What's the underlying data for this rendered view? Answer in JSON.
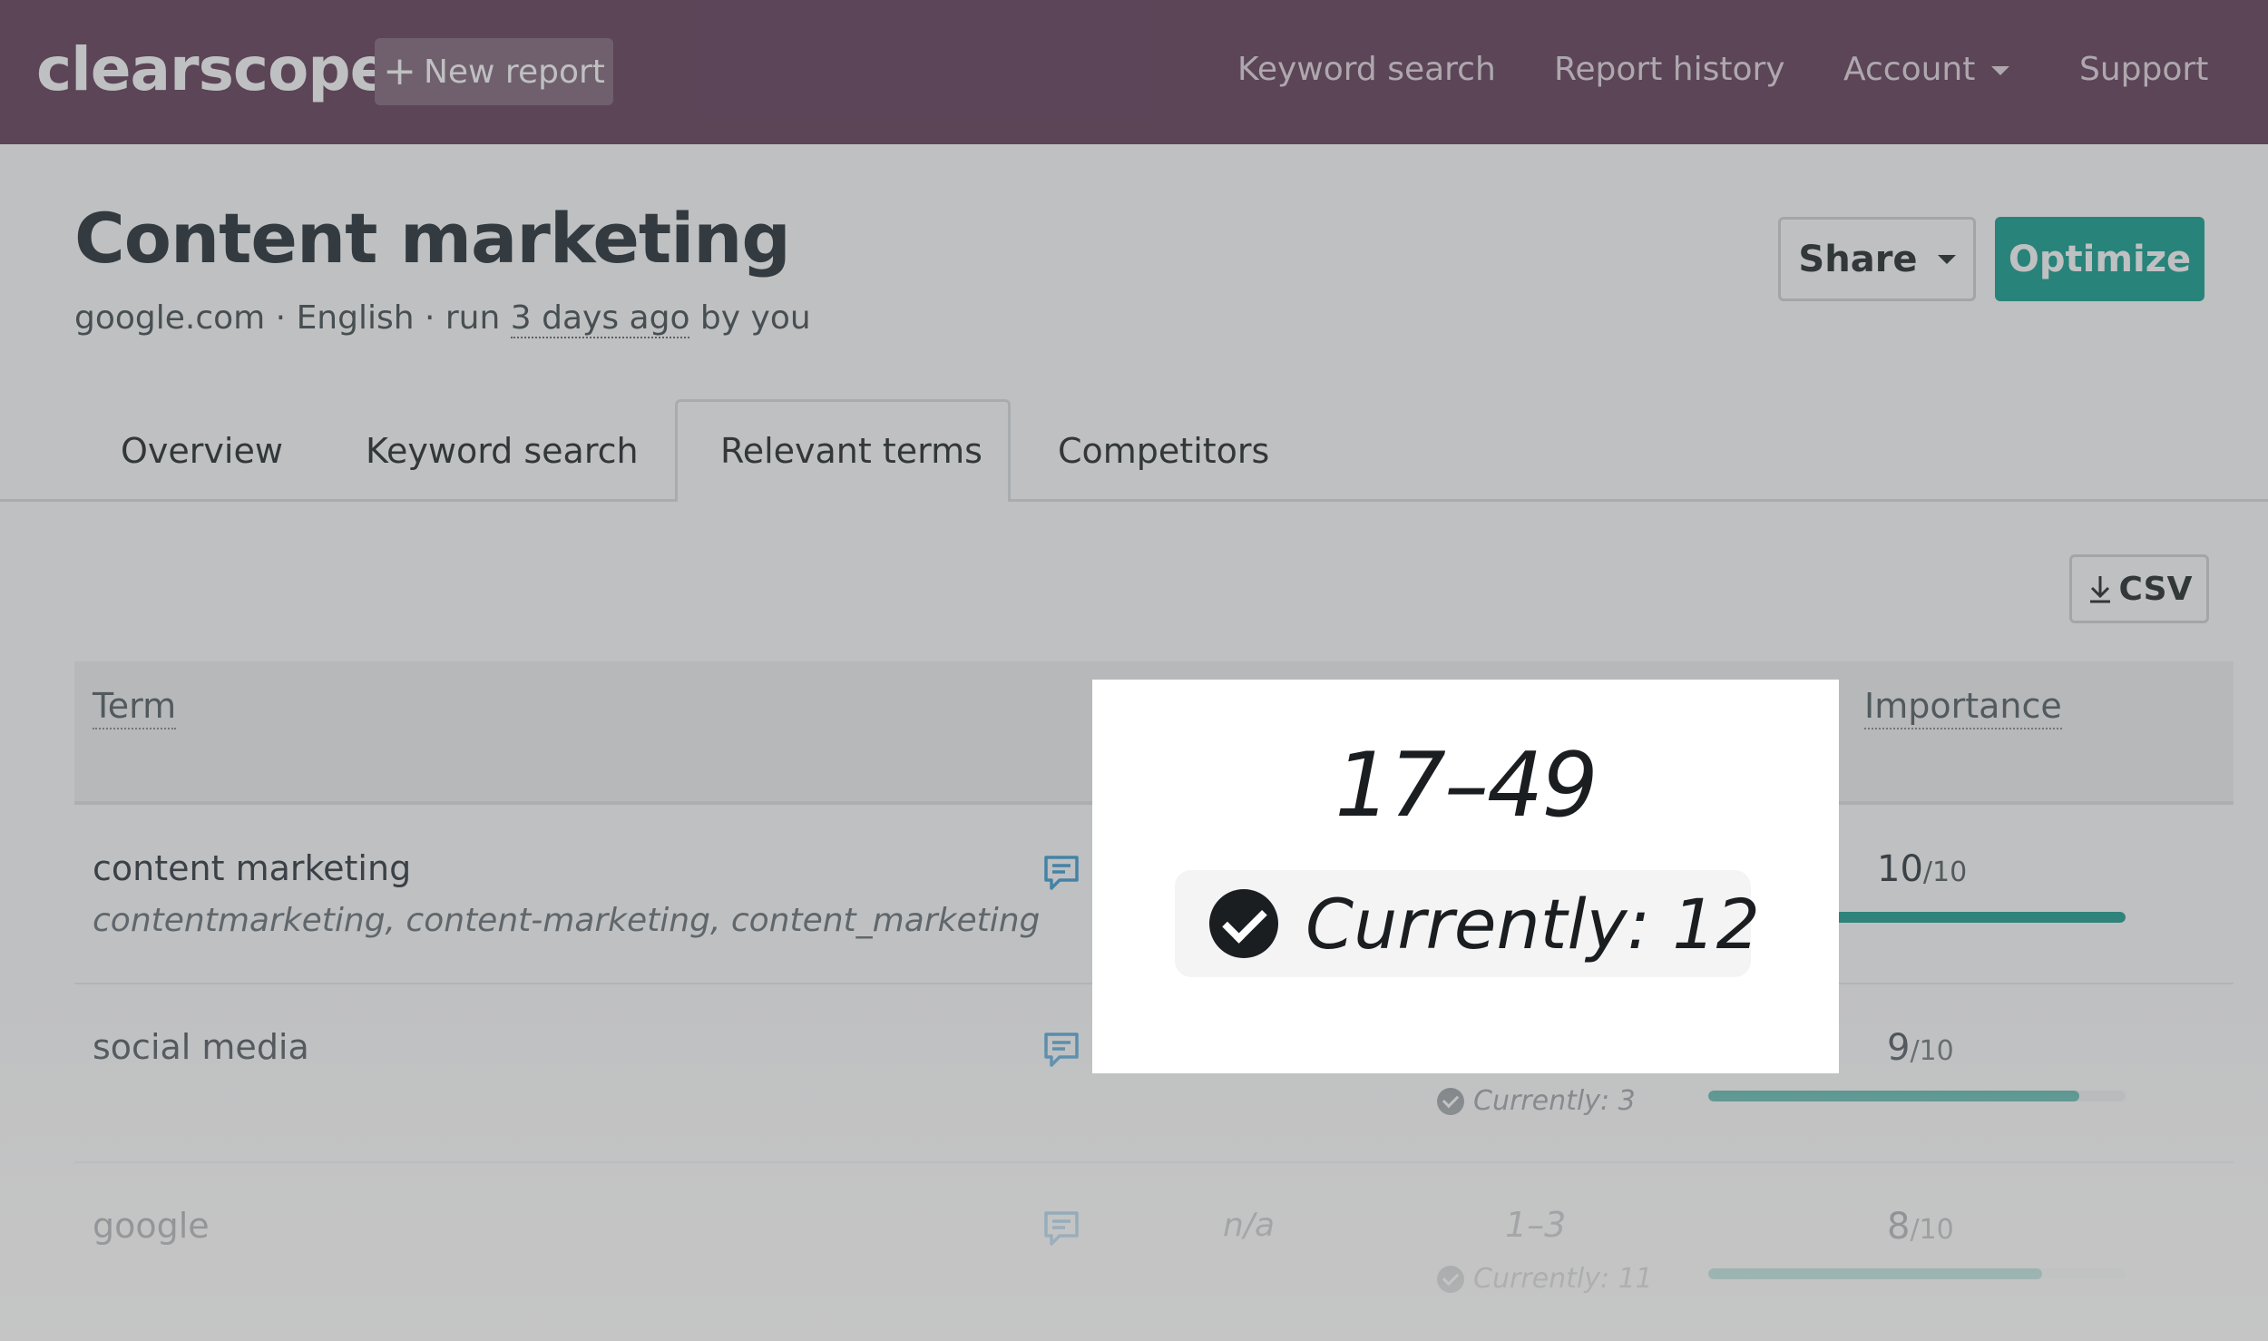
{
  "nav": {
    "logo": "clearscope",
    "new_report": "New report",
    "links": [
      "Keyword search",
      "Report history",
      "Account",
      "Support"
    ]
  },
  "header": {
    "title": "Content marketing",
    "meta_prefix": "google.com · English · run ",
    "meta_time": "3 days ago",
    "meta_suffix": " by you",
    "share": "Share",
    "optimize": "Optimize"
  },
  "tabs": [
    "Overview",
    "Keyword search",
    "Relevant terms",
    "Competitors"
  ],
  "active_tab": "Relevant terms",
  "toolbar": {
    "csv": "CSV"
  },
  "table": {
    "headers": {
      "term": "Term",
      "importance": "Importance"
    },
    "rows": [
      {
        "term": "content marketing",
        "variants": "contentmarketing, content-marketing, content_marketing",
        "importance": "10",
        "denominator": "/10",
        "importance_fraction": 1.0
      },
      {
        "term": "social media",
        "variants": "",
        "current": "Currently: 3",
        "importance": "9",
        "denominator": "/10",
        "importance_fraction": 0.9
      },
      {
        "term": "google",
        "variants": "",
        "uses": "n/a",
        "range": "1–3",
        "current": "Currently: 11",
        "importance": "8",
        "denominator": "/10",
        "importance_fraction": 0.8
      }
    ]
  },
  "spotlight": {
    "range": "17–49",
    "current": "Currently: 12"
  },
  "colors": {
    "nav_bg": "#6b4862",
    "accent": "#1fa496"
  }
}
